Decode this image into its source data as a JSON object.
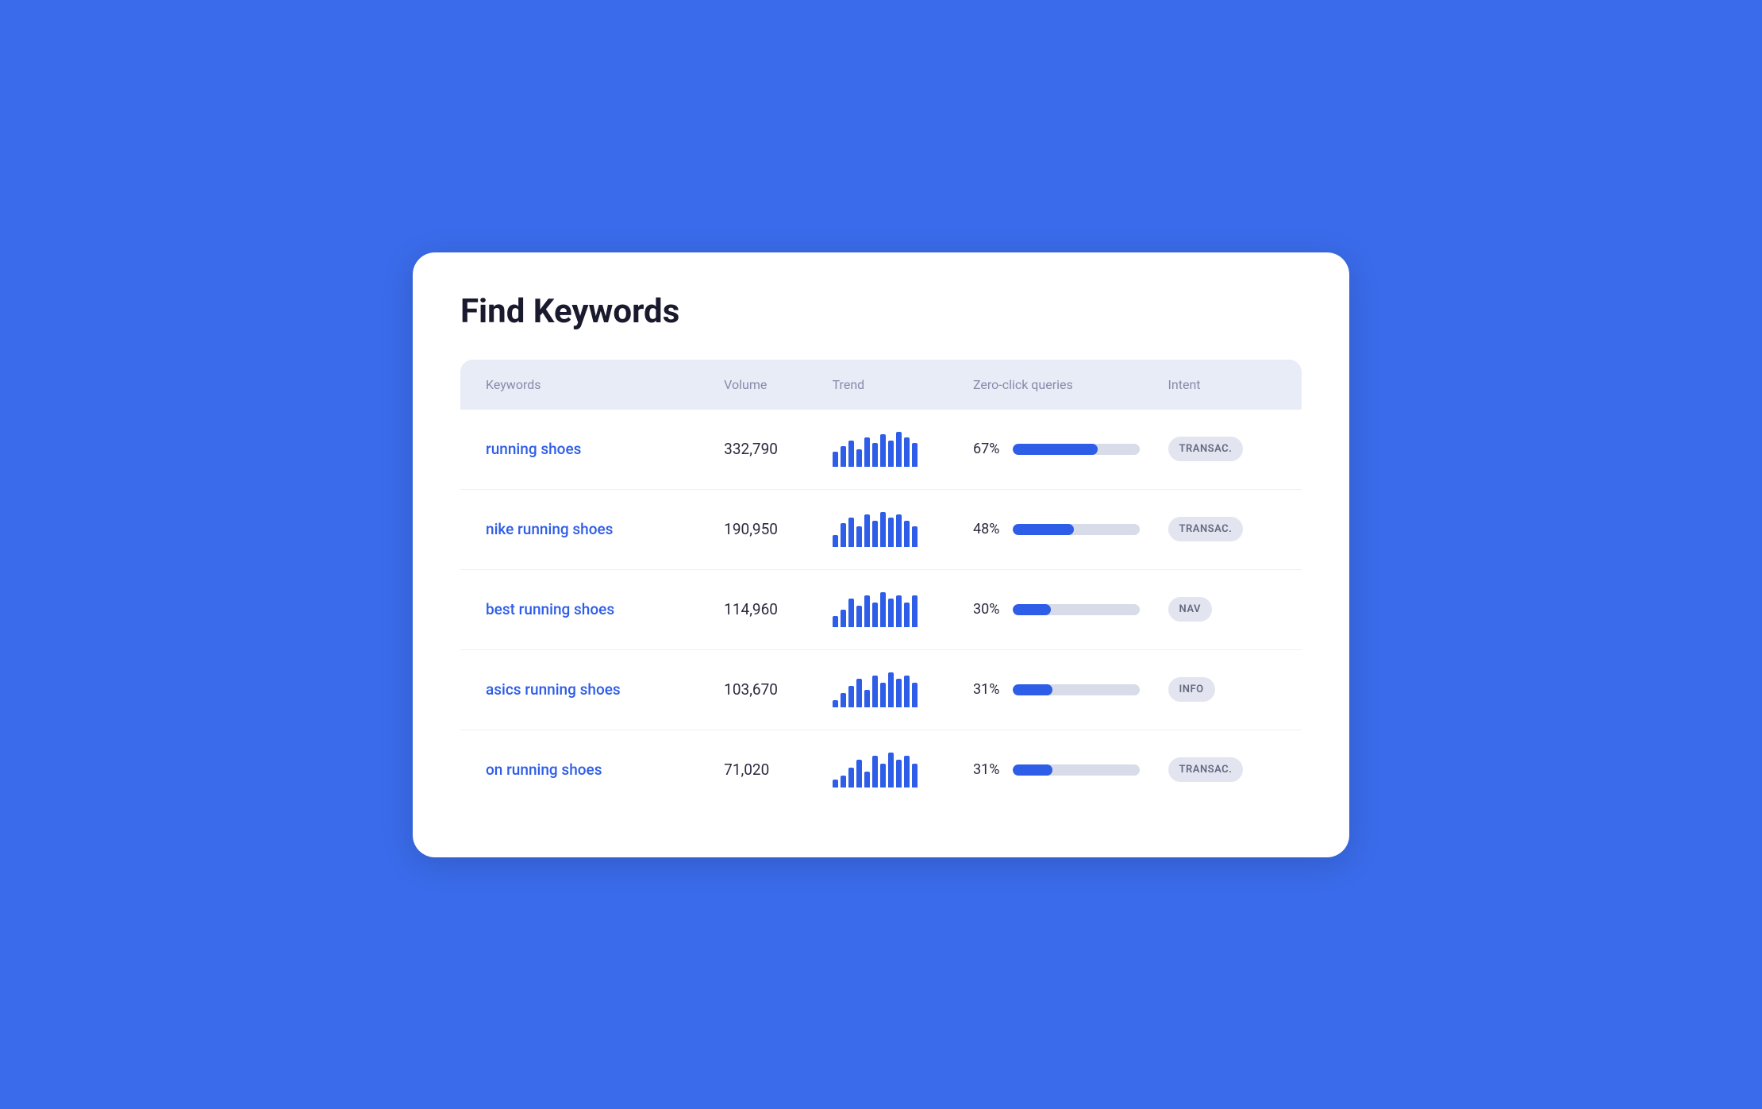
{
  "page": {
    "title": "Find Keywords"
  },
  "table": {
    "headers": [
      "Keywords",
      "Volume",
      "Trend",
      "Zero-click queries",
      "Intent"
    ],
    "rows": [
      {
        "keyword": "running shoes",
        "volume": "332,790",
        "trend_bars": [
          5,
          7,
          9,
          6,
          10,
          8,
          11,
          9,
          12,
          10,
          8
        ],
        "zero_click_pct": 67,
        "zero_click_label": "67%",
        "intent": "TRANSAC."
      },
      {
        "keyword": "nike running shoes",
        "volume": "190,950",
        "trend_bars": [
          4,
          8,
          10,
          7,
          11,
          9,
          12,
          10,
          11,
          9,
          7
        ],
        "zero_click_pct": 48,
        "zero_click_label": "48%",
        "intent": "TRANSAC."
      },
      {
        "keyword": "best running shoes",
        "volume": "114,960",
        "trend_bars": [
          3,
          5,
          8,
          6,
          9,
          7,
          10,
          8,
          9,
          7,
          9
        ],
        "zero_click_pct": 30,
        "zero_click_label": "30%",
        "intent": "NAV"
      },
      {
        "keyword": "asics running shoes",
        "volume": "103,670",
        "trend_bars": [
          2,
          4,
          6,
          8,
          5,
          9,
          7,
          10,
          8,
          9,
          7
        ],
        "zero_click_pct": 31,
        "zero_click_label": "31%",
        "intent": "INFO"
      },
      {
        "keyword": "on running shoes",
        "volume": "71,020",
        "trend_bars": [
          2,
          3,
          5,
          7,
          4,
          8,
          6,
          9,
          7,
          8,
          6
        ],
        "zero_click_pct": 31,
        "zero_click_label": "31%",
        "intent": "TRANSAC."
      }
    ]
  }
}
